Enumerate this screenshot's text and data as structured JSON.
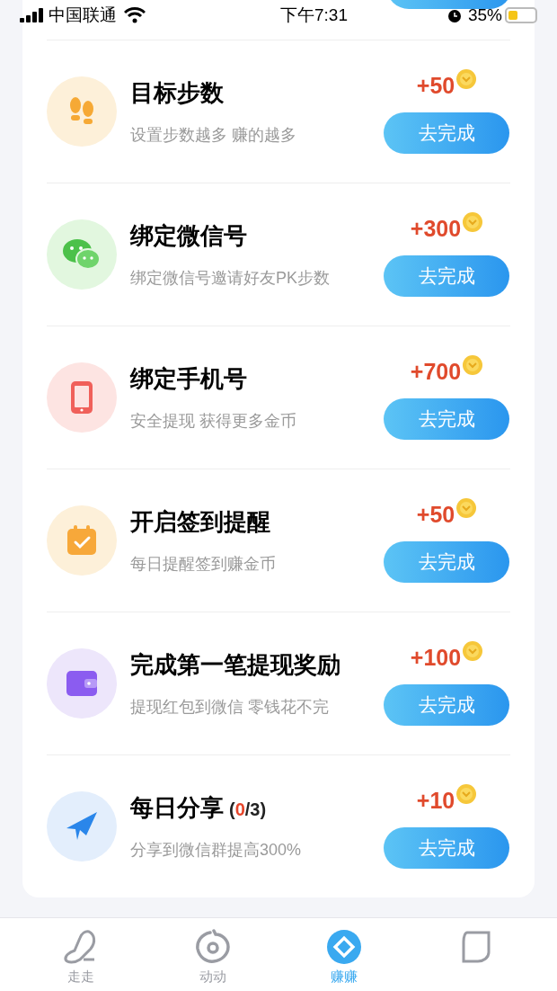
{
  "status_bar": {
    "carrier": "中国联通",
    "time": "下午7:31",
    "battery": "35%"
  },
  "tasks": [
    {
      "kind": "footprints",
      "color": "#fdf0d9",
      "title": "目标步数",
      "subtitle": "设置步数越多 赚的越多",
      "reward": "+50",
      "button": "去完成"
    },
    {
      "kind": "wechat",
      "color": "#e2f7df",
      "title": "绑定微信号",
      "subtitle": "绑定微信号邀请好友PK步数",
      "reward": "+300",
      "button": "去完成"
    },
    {
      "kind": "phone",
      "color": "#fde4e2",
      "title": "绑定手机号",
      "subtitle": "安全提现 获得更多金币",
      "reward": "+700",
      "button": "去完成"
    },
    {
      "kind": "calendar",
      "color": "#fdf0d9",
      "title": "开启签到提醒",
      "subtitle": "每日提醒签到赚金币",
      "reward": "+50",
      "button": "去完成"
    },
    {
      "kind": "wallet",
      "color": "#ede6fb",
      "title": "完成第一笔提现奖励",
      "subtitle": "提现红包到微信 零钱花不完",
      "reward": "+100",
      "button": "去完成"
    },
    {
      "kind": "plane",
      "color": "#e3eefc",
      "title": "每日分享",
      "progress_parts": [
        "(",
        "0",
        "/3)"
      ],
      "subtitle": "分享到微信群提高300%",
      "reward": "+10",
      "button": "去完成"
    }
  ],
  "tabs": [
    {
      "kind": "shoe",
      "label": "走走",
      "selected": false
    },
    {
      "kind": "ring",
      "label": "动动",
      "selected": false
    },
    {
      "kind": "diamond",
      "label": "赚赚",
      "selected": true
    },
    {
      "kind": "bubble",
      "selected": false
    }
  ]
}
